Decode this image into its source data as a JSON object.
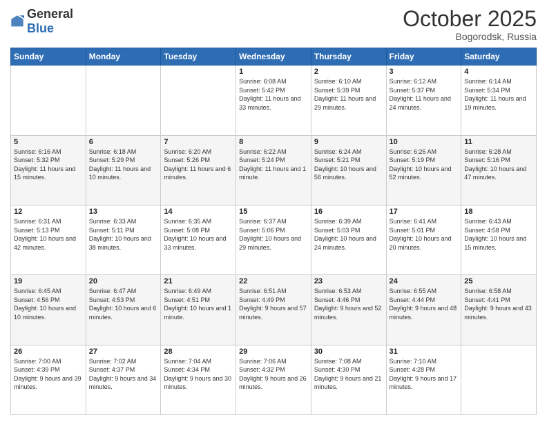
{
  "header": {
    "logo_general": "General",
    "logo_blue": "Blue",
    "month": "October 2025",
    "location": "Bogorodsk, Russia"
  },
  "weekdays": [
    "Sunday",
    "Monday",
    "Tuesday",
    "Wednesday",
    "Thursday",
    "Friday",
    "Saturday"
  ],
  "weeks": [
    [
      {
        "day": "",
        "sunrise": "",
        "sunset": "",
        "daylight": ""
      },
      {
        "day": "",
        "sunrise": "",
        "sunset": "",
        "daylight": ""
      },
      {
        "day": "",
        "sunrise": "",
        "sunset": "",
        "daylight": ""
      },
      {
        "day": "1",
        "sunrise": "Sunrise: 6:08 AM",
        "sunset": "Sunset: 5:42 PM",
        "daylight": "Daylight: 11 hours and 33 minutes."
      },
      {
        "day": "2",
        "sunrise": "Sunrise: 6:10 AM",
        "sunset": "Sunset: 5:39 PM",
        "daylight": "Daylight: 11 hours and 29 minutes."
      },
      {
        "day": "3",
        "sunrise": "Sunrise: 6:12 AM",
        "sunset": "Sunset: 5:37 PM",
        "daylight": "Daylight: 11 hours and 24 minutes."
      },
      {
        "day": "4",
        "sunrise": "Sunrise: 6:14 AM",
        "sunset": "Sunset: 5:34 PM",
        "daylight": "Daylight: 11 hours and 19 minutes."
      }
    ],
    [
      {
        "day": "5",
        "sunrise": "Sunrise: 6:16 AM",
        "sunset": "Sunset: 5:32 PM",
        "daylight": "Daylight: 11 hours and 15 minutes."
      },
      {
        "day": "6",
        "sunrise": "Sunrise: 6:18 AM",
        "sunset": "Sunset: 5:29 PM",
        "daylight": "Daylight: 11 hours and 10 minutes."
      },
      {
        "day": "7",
        "sunrise": "Sunrise: 6:20 AM",
        "sunset": "Sunset: 5:26 PM",
        "daylight": "Daylight: 11 hours and 6 minutes."
      },
      {
        "day": "8",
        "sunrise": "Sunrise: 6:22 AM",
        "sunset": "Sunset: 5:24 PM",
        "daylight": "Daylight: 11 hours and 1 minute."
      },
      {
        "day": "9",
        "sunrise": "Sunrise: 6:24 AM",
        "sunset": "Sunset: 5:21 PM",
        "daylight": "Daylight: 10 hours and 56 minutes."
      },
      {
        "day": "10",
        "sunrise": "Sunrise: 6:26 AM",
        "sunset": "Sunset: 5:19 PM",
        "daylight": "Daylight: 10 hours and 52 minutes."
      },
      {
        "day": "11",
        "sunrise": "Sunrise: 6:28 AM",
        "sunset": "Sunset: 5:16 PM",
        "daylight": "Daylight: 10 hours and 47 minutes."
      }
    ],
    [
      {
        "day": "12",
        "sunrise": "Sunrise: 6:31 AM",
        "sunset": "Sunset: 5:13 PM",
        "daylight": "Daylight: 10 hours and 42 minutes."
      },
      {
        "day": "13",
        "sunrise": "Sunrise: 6:33 AM",
        "sunset": "Sunset: 5:11 PM",
        "daylight": "Daylight: 10 hours and 38 minutes."
      },
      {
        "day": "14",
        "sunrise": "Sunrise: 6:35 AM",
        "sunset": "Sunset: 5:08 PM",
        "daylight": "Daylight: 10 hours and 33 minutes."
      },
      {
        "day": "15",
        "sunrise": "Sunrise: 6:37 AM",
        "sunset": "Sunset: 5:06 PM",
        "daylight": "Daylight: 10 hours and 29 minutes."
      },
      {
        "day": "16",
        "sunrise": "Sunrise: 6:39 AM",
        "sunset": "Sunset: 5:03 PM",
        "daylight": "Daylight: 10 hours and 24 minutes."
      },
      {
        "day": "17",
        "sunrise": "Sunrise: 6:41 AM",
        "sunset": "Sunset: 5:01 PM",
        "daylight": "Daylight: 10 hours and 20 minutes."
      },
      {
        "day": "18",
        "sunrise": "Sunrise: 6:43 AM",
        "sunset": "Sunset: 4:58 PM",
        "daylight": "Daylight: 10 hours and 15 minutes."
      }
    ],
    [
      {
        "day": "19",
        "sunrise": "Sunrise: 6:45 AM",
        "sunset": "Sunset: 4:56 PM",
        "daylight": "Daylight: 10 hours and 10 minutes."
      },
      {
        "day": "20",
        "sunrise": "Sunrise: 6:47 AM",
        "sunset": "Sunset: 4:53 PM",
        "daylight": "Daylight: 10 hours and 6 minutes."
      },
      {
        "day": "21",
        "sunrise": "Sunrise: 6:49 AM",
        "sunset": "Sunset: 4:51 PM",
        "daylight": "Daylight: 10 hours and 1 minute."
      },
      {
        "day": "22",
        "sunrise": "Sunrise: 6:51 AM",
        "sunset": "Sunset: 4:49 PM",
        "daylight": "Daylight: 9 hours and 57 minutes."
      },
      {
        "day": "23",
        "sunrise": "Sunrise: 6:53 AM",
        "sunset": "Sunset: 4:46 PM",
        "daylight": "Daylight: 9 hours and 52 minutes."
      },
      {
        "day": "24",
        "sunrise": "Sunrise: 6:55 AM",
        "sunset": "Sunset: 4:44 PM",
        "daylight": "Daylight: 9 hours and 48 minutes."
      },
      {
        "day": "25",
        "sunrise": "Sunrise: 6:58 AM",
        "sunset": "Sunset: 4:41 PM",
        "daylight": "Daylight: 9 hours and 43 minutes."
      }
    ],
    [
      {
        "day": "26",
        "sunrise": "Sunrise: 7:00 AM",
        "sunset": "Sunset: 4:39 PM",
        "daylight": "Daylight: 9 hours and 39 minutes."
      },
      {
        "day": "27",
        "sunrise": "Sunrise: 7:02 AM",
        "sunset": "Sunset: 4:37 PM",
        "daylight": "Daylight: 9 hours and 34 minutes."
      },
      {
        "day": "28",
        "sunrise": "Sunrise: 7:04 AM",
        "sunset": "Sunset: 4:34 PM",
        "daylight": "Daylight: 9 hours and 30 minutes."
      },
      {
        "day": "29",
        "sunrise": "Sunrise: 7:06 AM",
        "sunset": "Sunset: 4:32 PM",
        "daylight": "Daylight: 9 hours and 26 minutes."
      },
      {
        "day": "30",
        "sunrise": "Sunrise: 7:08 AM",
        "sunset": "Sunset: 4:30 PM",
        "daylight": "Daylight: 9 hours and 21 minutes."
      },
      {
        "day": "31",
        "sunrise": "Sunrise: 7:10 AM",
        "sunset": "Sunset: 4:28 PM",
        "daylight": "Daylight: 9 hours and 17 minutes."
      },
      {
        "day": "",
        "sunrise": "",
        "sunset": "",
        "daylight": ""
      }
    ]
  ]
}
